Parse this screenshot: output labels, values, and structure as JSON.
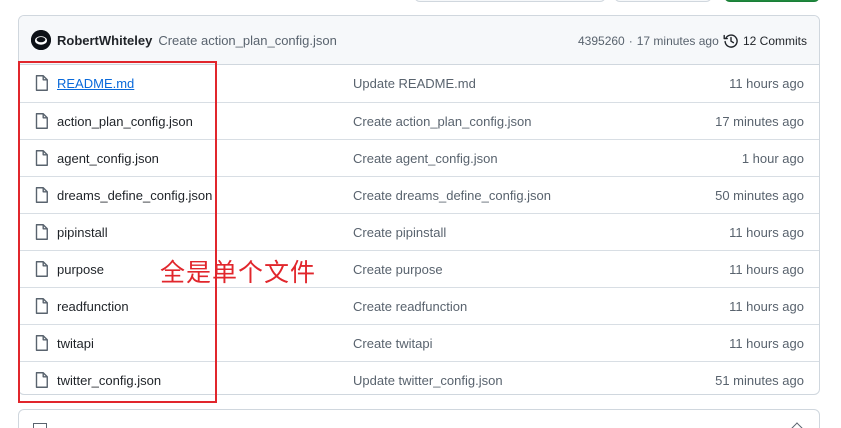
{
  "commit_header": {
    "author": "RobertWhiteley",
    "message": "Create action_plan_config.json",
    "hash": "4395260",
    "separator": "·",
    "time": "17 minutes ago",
    "commits_label": "12 Commits"
  },
  "files": [
    {
      "name": "README.md",
      "message": "Update README.md",
      "time": "11 hours ago"
    },
    {
      "name": "action_plan_config.json",
      "message": "Create action_plan_config.json",
      "time": "17 minutes ago"
    },
    {
      "name": "agent_config.json",
      "message": "Create agent_config.json",
      "time": "1 hour ago"
    },
    {
      "name": "dreams_define_config.json",
      "message": "Create dreams_define_config.json",
      "time": "50 minutes ago"
    },
    {
      "name": "pipinstall",
      "message": "Create pipinstall",
      "time": "11 hours ago"
    },
    {
      "name": "purpose",
      "message": "Create purpose",
      "time": "11 hours ago"
    },
    {
      "name": "readfunction",
      "message": "Create readfunction",
      "time": "11 hours ago"
    },
    {
      "name": "twitapi",
      "message": "Create twitapi",
      "time": "11 hours ago"
    },
    {
      "name": "twitter_config.json",
      "message": "Update twitter_config.json",
      "time": "51 minutes ago"
    }
  ],
  "annotation": {
    "text": "全是单个文件",
    "color": "#e1262c"
  },
  "icons": {
    "avatar": "avatar-icon",
    "history": "history-icon",
    "file": "file-icon",
    "book": "book-icon",
    "pencil": "pencil-icon"
  },
  "colors": {
    "link": "#0969da",
    "muted": "#59636e",
    "border": "#d0d7de",
    "header_bg": "#f6f8fa"
  }
}
